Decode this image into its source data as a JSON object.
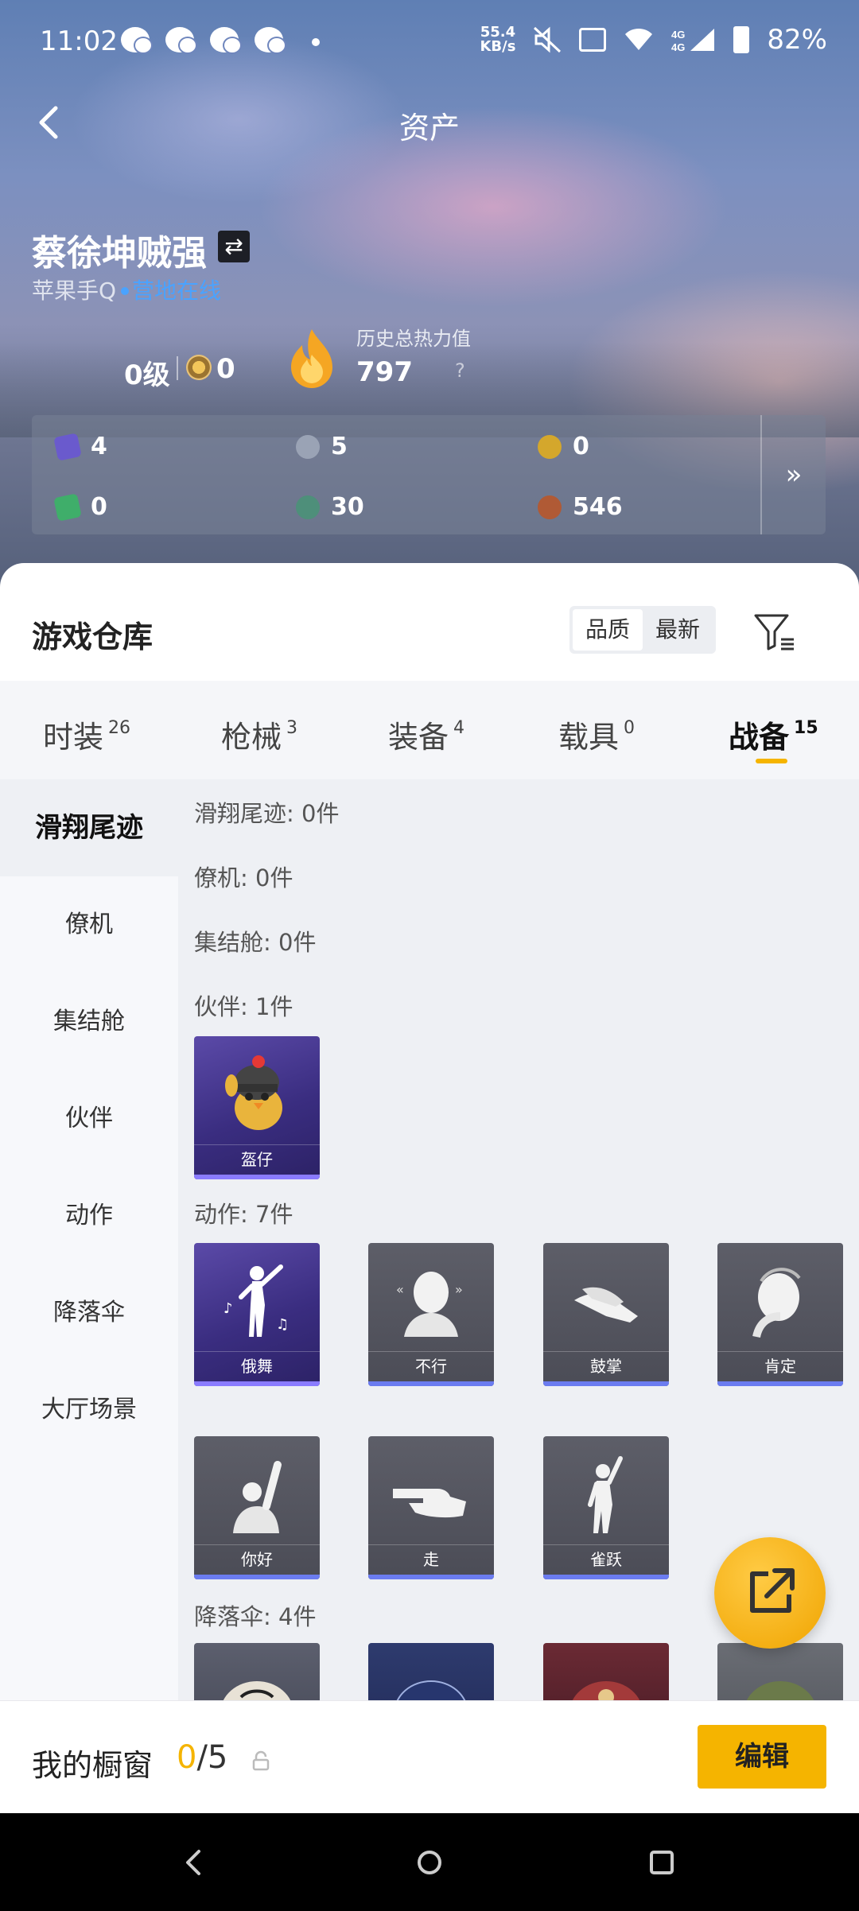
{
  "status_bar": {
    "time": "11:02",
    "net_speed_value": "55.4",
    "net_speed_unit": "KB/s",
    "network": "4G 4G",
    "battery": "82%"
  },
  "header": {
    "title": "资产",
    "player_name": "蔡徐坤贼强",
    "platform": "苹果手Q",
    "online_status": "营地在线",
    "level": "0级",
    "rank_value": "0",
    "heat_label": "历史总热力值",
    "heat_value": "797",
    "heat_help": "?"
  },
  "currency": [
    {
      "icon": "purple-card-icon",
      "value": "4",
      "color": "#6a5acd"
    },
    {
      "icon": "silver-coin-icon",
      "value": "5",
      "color": "#9aa3b5"
    },
    {
      "icon": "gold-coin-icon",
      "value": "0",
      "color": "#d4a72c"
    },
    {
      "icon": "green-card-icon",
      "value": "0",
      "color": "#3fae6a"
    },
    {
      "icon": "green-orb-icon",
      "value": "30",
      "color": "#4e8f7a"
    },
    {
      "icon": "bronze-coin-icon",
      "value": "546",
      "color": "#b05a35"
    }
  ],
  "warehouse": {
    "title": "游戏仓库",
    "sort_options": [
      "品质",
      "最新"
    ],
    "tabs": [
      {
        "label": "时装",
        "count": "26"
      },
      {
        "label": "枪械",
        "count": "3"
      },
      {
        "label": "装备",
        "count": "4"
      },
      {
        "label": "载具",
        "count": "0"
      },
      {
        "label": "战备",
        "count": "15"
      }
    ],
    "side_items": [
      "滑翔尾迹",
      "僚机",
      "集结舱",
      "伙伴",
      "动作",
      "降落伞",
      "大厅场景"
    ],
    "groups": {
      "glide": "滑翔尾迹: 0件",
      "wingman": "僚机: 0件",
      "capsule": "集结舱: 0件",
      "partner": "伙伴: 1件",
      "emote": "动作: 7件",
      "parachute": "降落伞: 4件"
    },
    "partner_items": [
      "盔仔"
    ],
    "emote_items": [
      "俄舞",
      "不行",
      "鼓掌",
      "肯定",
      "你好",
      "走",
      "雀跃"
    ]
  },
  "showcase": {
    "label": "我的橱窗",
    "current": "0",
    "total": "/5",
    "edit": "编辑"
  }
}
